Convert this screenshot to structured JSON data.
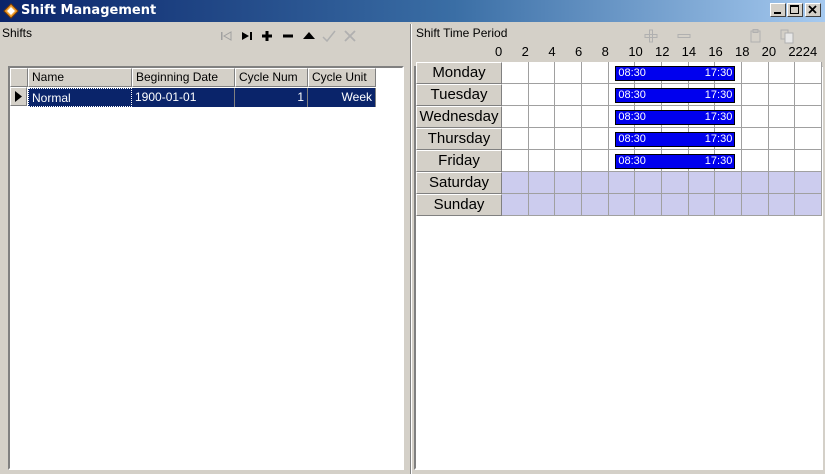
{
  "window": {
    "title": "Shift Management"
  },
  "shifts": {
    "label": "Shifts",
    "toolbar": [
      "first-icon",
      "last-icon",
      "add-icon",
      "delete-icon",
      "move-up-icon",
      "confirm-icon",
      "cancel-icon"
    ],
    "columns": [
      "Name",
      "Beginning Date",
      "Cycle Num",
      "Cycle Unit"
    ],
    "rows": [
      {
        "name": "Normal",
        "beginning_date": "1900-01-01",
        "cycle_num": "1",
        "cycle_unit": "Week"
      }
    ]
  },
  "schedule": {
    "label": "Shift Time Period",
    "toolbar": [
      "add-period-icon",
      "remove-period-icon",
      "paste-icon",
      "copy-icon"
    ],
    "hours": [
      "0",
      "2",
      "4",
      "6",
      "8",
      "10",
      "12",
      "14",
      "16",
      "18",
      "20",
      "2224"
    ],
    "days": [
      {
        "name": "Monday",
        "working": true,
        "start": "08:30",
        "end": "17:30"
      },
      {
        "name": "Tuesday",
        "working": true,
        "start": "08:30",
        "end": "17:30"
      },
      {
        "name": "Wednesday",
        "working": true,
        "start": "08:30",
        "end": "17:30"
      },
      {
        "name": "Thursday",
        "working": true,
        "start": "08:30",
        "end": "17:30"
      },
      {
        "name": "Friday",
        "working": true,
        "start": "08:30",
        "end": "17:30"
      },
      {
        "name": "Saturday",
        "working": false
      },
      {
        "name": "Sunday",
        "working": false
      }
    ],
    "colors": {
      "period_bar": "#0000ee",
      "non_working": "#ccccee",
      "selected_row": "#0a246a"
    }
  }
}
